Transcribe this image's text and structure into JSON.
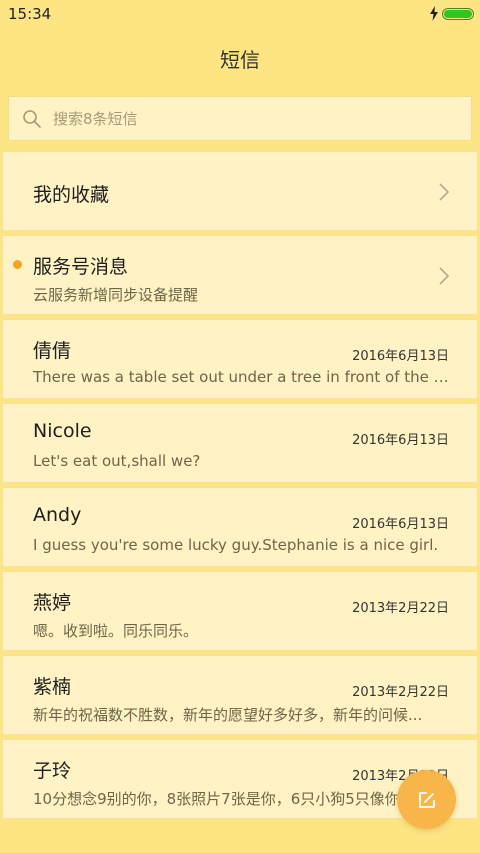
{
  "status_bar": {
    "time": "15:34",
    "icons": [
      "charging-icon",
      "battery-icon"
    ],
    "battery_color": "#33c51d"
  },
  "header": {
    "title": "短信"
  },
  "search": {
    "placeholder": "搜索8条短信",
    "value": ""
  },
  "pinned": [
    {
      "title": "我的收藏",
      "icon": "chevron-right-icon"
    },
    {
      "title": "服务号消息",
      "subtitle": "云服务新增同步设备提醒",
      "unread": true,
      "icon": "chevron-right-icon"
    }
  ],
  "conversations": [
    {
      "name": "倩倩",
      "date": "2016年6月13日",
      "preview": "There was a table set out under a tree in front of the ho..."
    },
    {
      "name": "Nicole",
      "date": "2016年6月13日",
      "preview": "Let's eat out,shall we?"
    },
    {
      "name": "Andy",
      "date": "2016年6月13日",
      "preview": "I guess you're some lucky guy.Stephanie is a nice girl."
    },
    {
      "name": "燕婷",
      "date": "2013年2月22日",
      "preview": "嗯。收到啦。同乐同乐。"
    },
    {
      "name": "紫楠",
      "date": "2013年2月22日",
      "preview": "新年的祝福数不胜数，新年的愿望好多好多，新年的问候..."
    },
    {
      "name": "子玲",
      "date": "2013年2月22日",
      "preview": "10分想念9别的你，8张照片7张是你，6只小狗5只像你..."
    }
  ],
  "fab": {
    "icon": "compose-icon",
    "color": "#f8b64a"
  },
  "colors": {
    "background": "#fde584",
    "card": "#fff3c5",
    "unread_dot": "#f4a524"
  }
}
